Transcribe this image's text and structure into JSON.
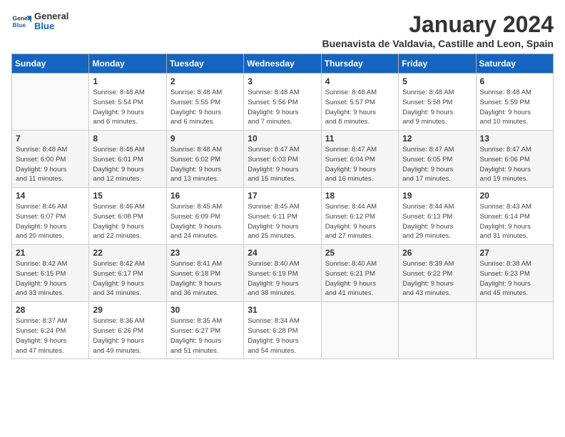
{
  "logo": {
    "general": "General",
    "blue": "Blue"
  },
  "header": {
    "month_year": "January 2024",
    "location": "Buenavista de Valdavia, Castille and Leon, Spain"
  },
  "weekdays": [
    "Sunday",
    "Monday",
    "Tuesday",
    "Wednesday",
    "Thursday",
    "Friday",
    "Saturday"
  ],
  "weeks": [
    [
      {
        "day": "",
        "info": ""
      },
      {
        "day": "1",
        "info": "Sunrise: 8:48 AM\nSunset: 5:54 PM\nDaylight: 9 hours\nand 6 minutes."
      },
      {
        "day": "2",
        "info": "Sunrise: 8:48 AM\nSunset: 5:55 PM\nDaylight: 9 hours\nand 6 minutes."
      },
      {
        "day": "3",
        "info": "Sunrise: 8:48 AM\nSunset: 5:56 PM\nDaylight: 9 hours\nand 7 minutes."
      },
      {
        "day": "4",
        "info": "Sunrise: 8:48 AM\nSunset: 5:57 PM\nDaylight: 9 hours\nand 8 minutes."
      },
      {
        "day": "5",
        "info": "Sunrise: 8:48 AM\nSunset: 5:58 PM\nDaylight: 9 hours\nand 9 minutes."
      },
      {
        "day": "6",
        "info": "Sunrise: 8:48 AM\nSunset: 5:59 PM\nDaylight: 9 hours\nand 10 minutes."
      }
    ],
    [
      {
        "day": "7",
        "info": "Sunrise: 8:48 AM\nSunset: 6:00 PM\nDaylight: 9 hours\nand 11 minutes."
      },
      {
        "day": "8",
        "info": "Sunrise: 8:48 AM\nSunset: 6:01 PM\nDaylight: 9 hours\nand 12 minutes."
      },
      {
        "day": "9",
        "info": "Sunrise: 8:48 AM\nSunset: 6:02 PM\nDaylight: 9 hours\nand 13 minutes."
      },
      {
        "day": "10",
        "info": "Sunrise: 8:47 AM\nSunset: 6:03 PM\nDaylight: 9 hours\nand 15 minutes."
      },
      {
        "day": "11",
        "info": "Sunrise: 8:47 AM\nSunset: 6:04 PM\nDaylight: 9 hours\nand 16 minutes."
      },
      {
        "day": "12",
        "info": "Sunrise: 8:47 AM\nSunset: 6:05 PM\nDaylight: 9 hours\nand 17 minutes."
      },
      {
        "day": "13",
        "info": "Sunrise: 8:47 AM\nSunset: 6:06 PM\nDaylight: 9 hours\nand 19 minutes."
      }
    ],
    [
      {
        "day": "14",
        "info": "Sunrise: 8:46 AM\nSunset: 6:07 PM\nDaylight: 9 hours\nand 20 minutes."
      },
      {
        "day": "15",
        "info": "Sunrise: 8:46 AM\nSunset: 6:08 PM\nDaylight: 9 hours\nand 22 minutes."
      },
      {
        "day": "16",
        "info": "Sunrise: 8:45 AM\nSunset: 6:09 PM\nDaylight: 9 hours\nand 24 minutes."
      },
      {
        "day": "17",
        "info": "Sunrise: 8:45 AM\nSunset: 6:11 PM\nDaylight: 9 hours\nand 25 minutes."
      },
      {
        "day": "18",
        "info": "Sunrise: 8:44 AM\nSunset: 6:12 PM\nDaylight: 9 hours\nand 27 minutes."
      },
      {
        "day": "19",
        "info": "Sunrise: 8:44 AM\nSunset: 6:13 PM\nDaylight: 9 hours\nand 29 minutes."
      },
      {
        "day": "20",
        "info": "Sunrise: 8:43 AM\nSunset: 6:14 PM\nDaylight: 9 hours\nand 31 minutes."
      }
    ],
    [
      {
        "day": "21",
        "info": "Sunrise: 8:42 AM\nSunset: 6:15 PM\nDaylight: 9 hours\nand 33 minutes."
      },
      {
        "day": "22",
        "info": "Sunrise: 8:42 AM\nSunset: 6:17 PM\nDaylight: 9 hours\nand 34 minutes."
      },
      {
        "day": "23",
        "info": "Sunrise: 8:41 AM\nSunset: 6:18 PM\nDaylight: 9 hours\nand 36 minutes."
      },
      {
        "day": "24",
        "info": "Sunrise: 8:40 AM\nSunset: 6:19 PM\nDaylight: 9 hours\nand 38 minutes."
      },
      {
        "day": "25",
        "info": "Sunrise: 8:40 AM\nSunset: 6:21 PM\nDaylight: 9 hours\nand 41 minutes."
      },
      {
        "day": "26",
        "info": "Sunrise: 8:39 AM\nSunset: 6:22 PM\nDaylight: 9 hours\nand 43 minutes."
      },
      {
        "day": "27",
        "info": "Sunrise: 8:38 AM\nSunset: 6:23 PM\nDaylight: 9 hours\nand 45 minutes."
      }
    ],
    [
      {
        "day": "28",
        "info": "Sunrise: 8:37 AM\nSunset: 6:24 PM\nDaylight: 9 hours\nand 47 minutes."
      },
      {
        "day": "29",
        "info": "Sunrise: 8:36 AM\nSunset: 6:26 PM\nDaylight: 9 hours\nand 49 minutes."
      },
      {
        "day": "30",
        "info": "Sunrise: 8:35 AM\nSunset: 6:27 PM\nDaylight: 9 hours\nand 51 minutes."
      },
      {
        "day": "31",
        "info": "Sunrise: 8:34 AM\nSunset: 6:28 PM\nDaylight: 9 hours\nand 54 minutes."
      },
      {
        "day": "",
        "info": ""
      },
      {
        "day": "",
        "info": ""
      },
      {
        "day": "",
        "info": ""
      }
    ]
  ]
}
